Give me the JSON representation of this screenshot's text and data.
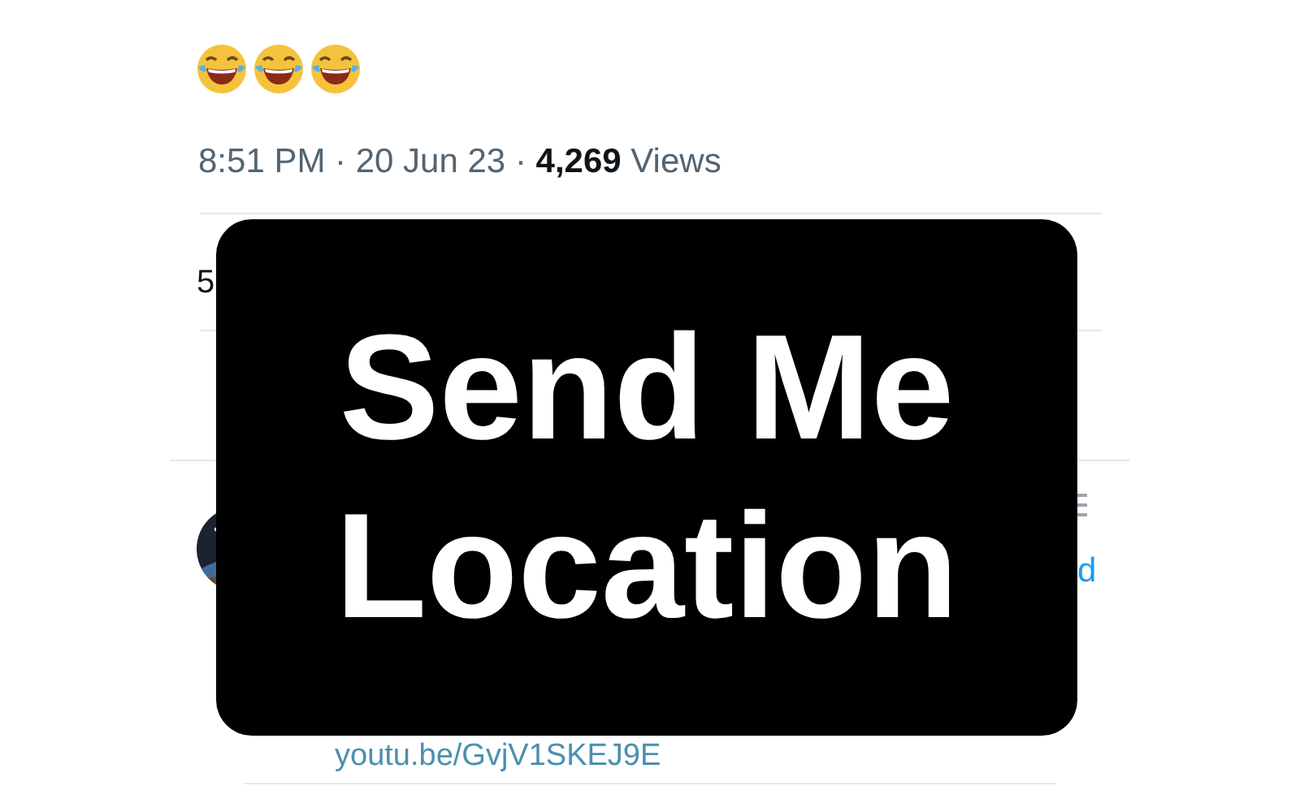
{
  "tweet": {
    "emojis": [
      {
        "kind": "tears-of-joy"
      },
      {
        "kind": "tears-of-joy"
      },
      {
        "kind": "tears-of-joy"
      }
    ],
    "meta": "8:51 PM · 20 Jun 23 · **4,269** Views",
    "stat_fragment": "5"
  },
  "reply": {
    "text_fragment": "d",
    "link": "youtu.be/GvjV1SKEJ9E"
  },
  "overlay": {
    "lines": [
      "Send Me",
      "Location"
    ]
  }
}
